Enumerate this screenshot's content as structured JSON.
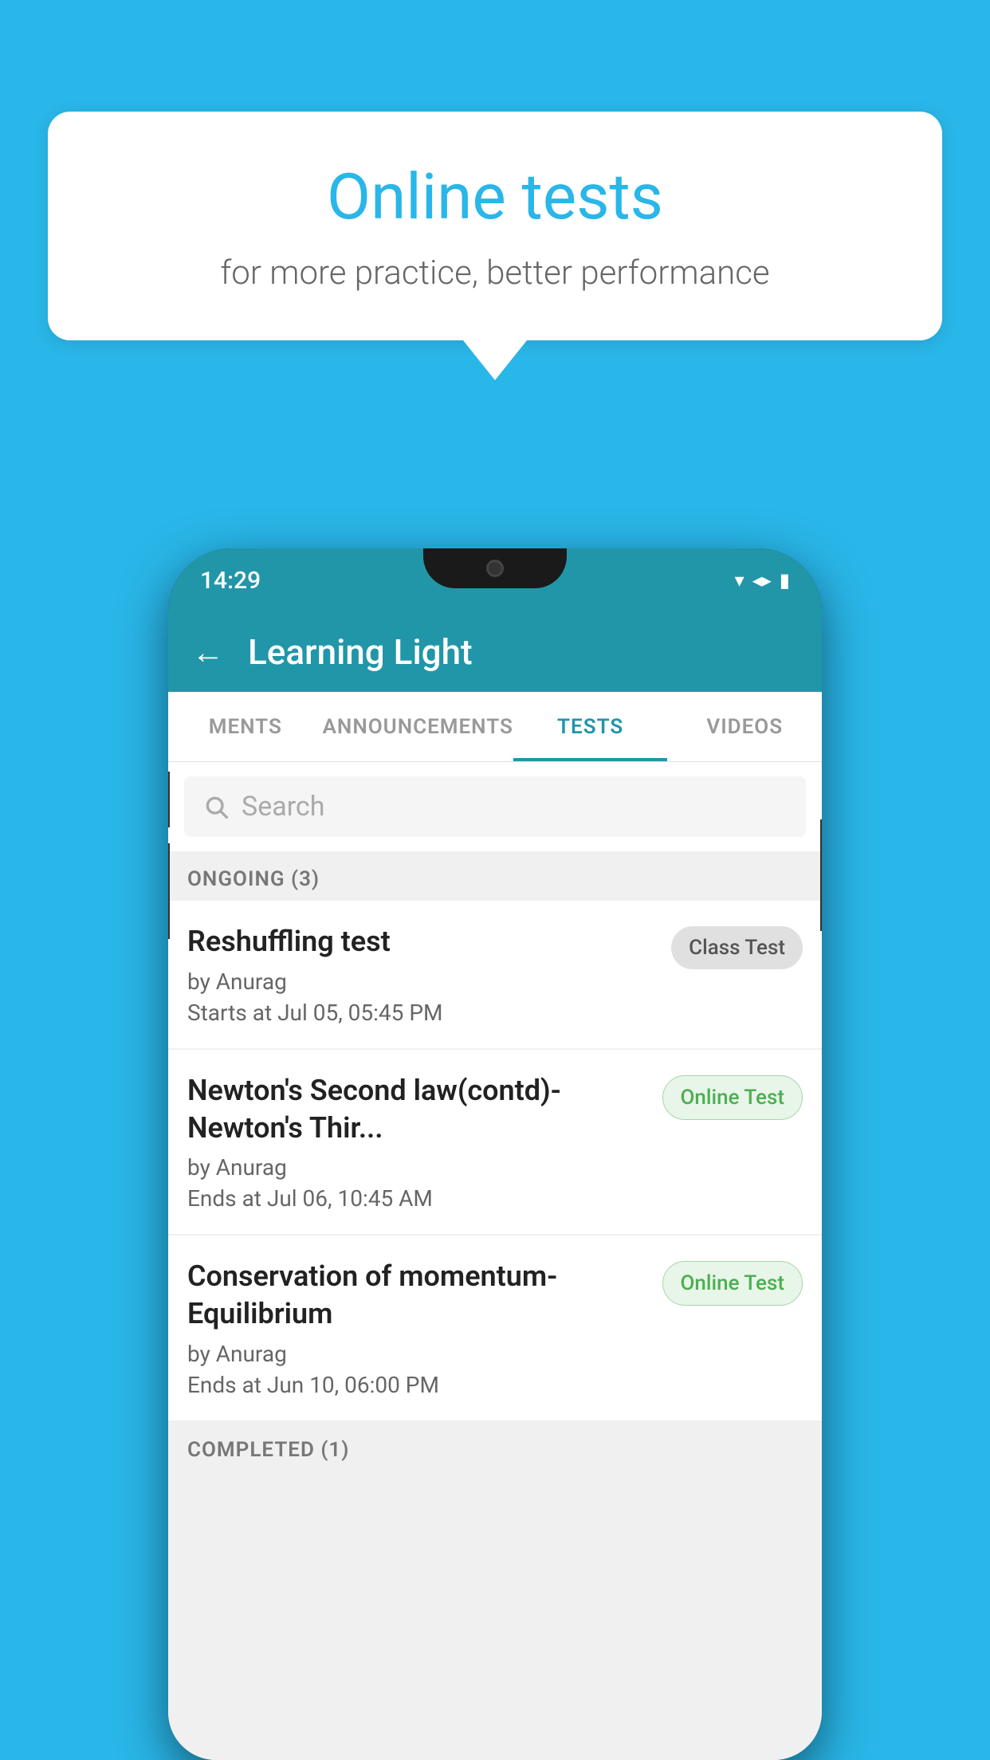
{
  "background": {
    "color": "#29b6e8"
  },
  "speech_bubble": {
    "title": "Online tests",
    "subtitle": "for more practice, better performance"
  },
  "phone": {
    "status_bar": {
      "time": "14:29"
    },
    "header": {
      "title": "Learning Light",
      "back_label": "←"
    },
    "tabs": [
      {
        "label": "MENTS",
        "active": false
      },
      {
        "label": "ANNOUNCEMENTS",
        "active": false
      },
      {
        "label": "TESTS",
        "active": true
      },
      {
        "label": "VIDEOS",
        "active": false
      }
    ],
    "search": {
      "placeholder": "Search"
    },
    "ongoing_section": {
      "label": "ONGOING (3)"
    },
    "tests": [
      {
        "title": "Reshuffling test",
        "author": "by Anurag",
        "time_label": "Starts at  Jul 05, 05:45 PM",
        "badge": "Class Test",
        "badge_type": "class"
      },
      {
        "title": "Newton's Second law(contd)-Newton's Thir...",
        "author": "by Anurag",
        "time_label": "Ends at  Jul 06, 10:45 AM",
        "badge": "Online Test",
        "badge_type": "online"
      },
      {
        "title": "Conservation of momentum-Equilibrium",
        "author": "by Anurag",
        "time_label": "Ends at  Jun 10, 06:00 PM",
        "badge": "Online Test",
        "badge_type": "online"
      }
    ],
    "completed_section": {
      "label": "COMPLETED (1)"
    }
  }
}
